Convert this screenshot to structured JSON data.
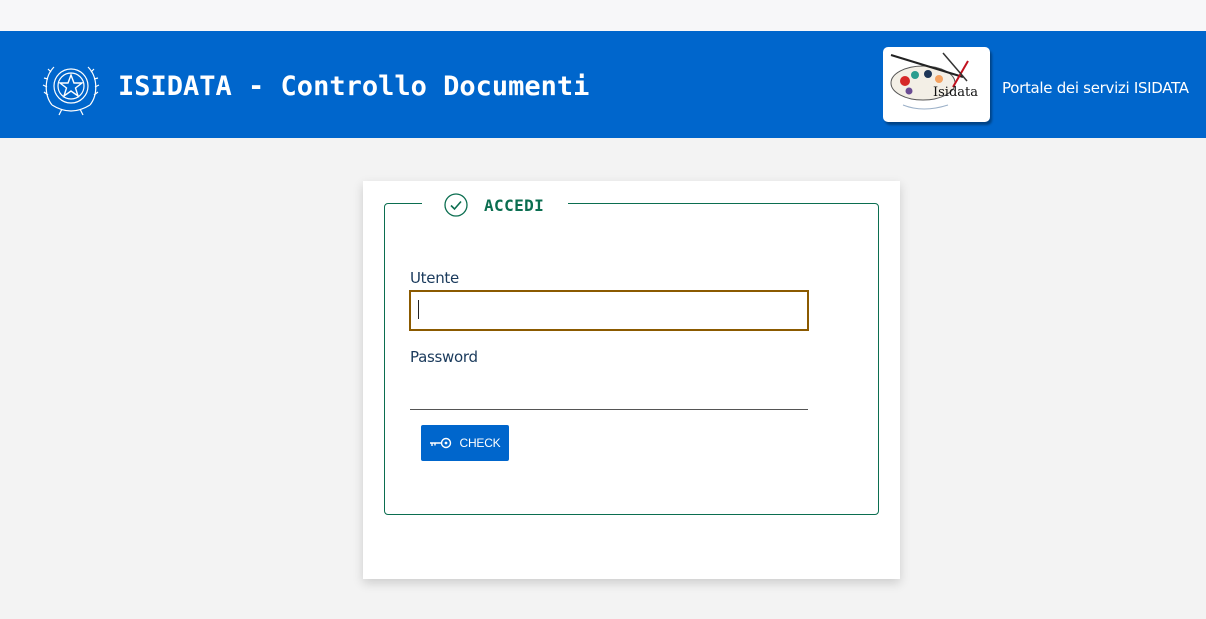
{
  "header": {
    "title": "ISIDATA - Controllo Documenti",
    "emblem_icon": "italian-republic-emblem-icon",
    "logo_icon": "isidata-logo",
    "logo_text": "Isidata",
    "portal_link_label": "Portale dei servizi ISIDATA",
    "background_color": "#0066cc"
  },
  "login": {
    "legend": "ACCEDI",
    "legend_icon": "check-circle-icon",
    "user_label": "Utente",
    "user_value": "",
    "password_label": "Password",
    "password_value": "",
    "button_label": "CHECK",
    "button_icon": "key-icon",
    "accent_color": "#0b6e50",
    "button_color": "#0066cc"
  }
}
